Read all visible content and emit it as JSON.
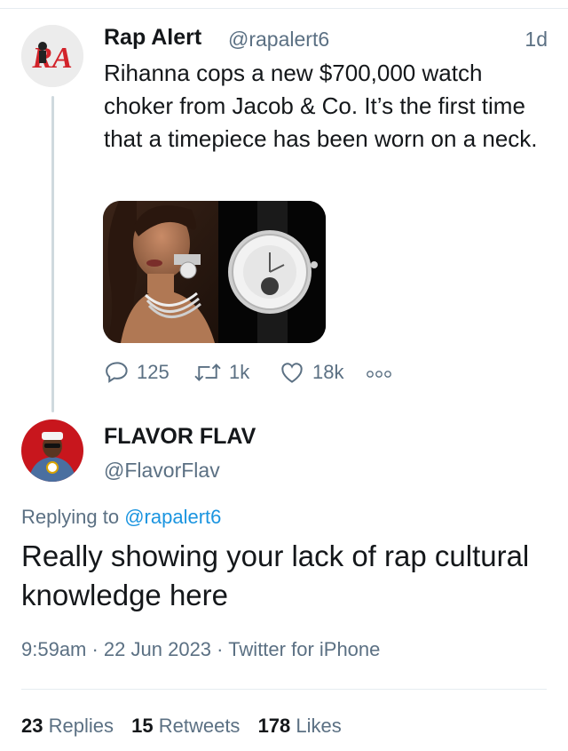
{
  "original_tweet": {
    "avatar_text": "RA",
    "author_name": "Rap Alert",
    "author_handle": "@rapalert6",
    "time_ago": "1d",
    "text": "Rihanna cops a new $700,000 watch choker from Jacob & Co. It’s the first time that a timepiece has been worn on a neck.",
    "actions": {
      "replies": "125",
      "retweets": "1k",
      "likes": "18k"
    }
  },
  "reply_tweet": {
    "author_name": "FLAVOR FLAV",
    "author_handle": "@FlavorFlav",
    "replying_label": "Replying to",
    "replying_to": "@rapalert6",
    "text": "Really showing your lack of rap cultural knowledge here",
    "meta": "9:59am · 22 Jun 2023 · Twitter for iPhone",
    "stats": {
      "replies_count": "23",
      "replies_label": "Replies",
      "retweets_count": "15",
      "retweets_label": "Retweets",
      "likes_count": "178",
      "likes_label": "Likes"
    }
  },
  "colors": {
    "text": "#14171a",
    "secondary": "#5b7083",
    "link": "#1b95e0",
    "brand_red": "#d2232a"
  },
  "icons": [
    "reply-icon",
    "retweet-icon",
    "like-icon",
    "more-icon"
  ]
}
